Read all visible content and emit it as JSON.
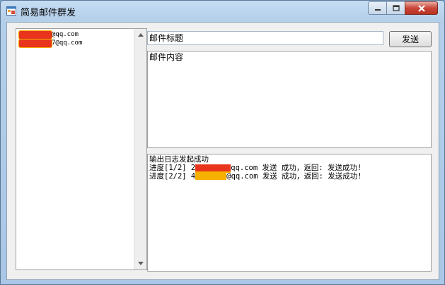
{
  "window": {
    "title": "简易邮件群发"
  },
  "recipients": [
    {
      "prefix": "",
      "suffix": "@qq.com",
      "mask_color": "#e8341c",
      "mask_glow": "#f5a800"
    },
    {
      "prefix": "",
      "suffix": "7@qq.com",
      "mask_color": "#e8341c",
      "mask_glow": "#f5b000"
    }
  ],
  "subject": {
    "value": "邮件标题"
  },
  "send_button": {
    "label": "发送"
  },
  "body": {
    "value": "邮件内容"
  },
  "log": {
    "lines": [
      {
        "before": "输出日志发起成功",
        "after": ""
      },
      {
        "before": "进度[1/2] 2",
        "after": "qq.com 发送 成功，返回: 发送成功!"
      },
      {
        "before": "进度[2/2] 4",
        "after": "@qq.com 发送 成功，返回: 发送成功!"
      }
    ]
  },
  "colors": {
    "titlebar": "#c6dcf2",
    "close_button": "#c9453a",
    "redact_red": "#e8341c",
    "redact_yellow": "#f5b000"
  },
  "icons": {
    "app": "app-window-icon",
    "minimize": "minimize-icon",
    "maximize": "maximize-icon",
    "close": "close-icon",
    "scroll_up": "scroll-up-arrow-icon",
    "scroll_down": "scroll-down-arrow-icon"
  }
}
